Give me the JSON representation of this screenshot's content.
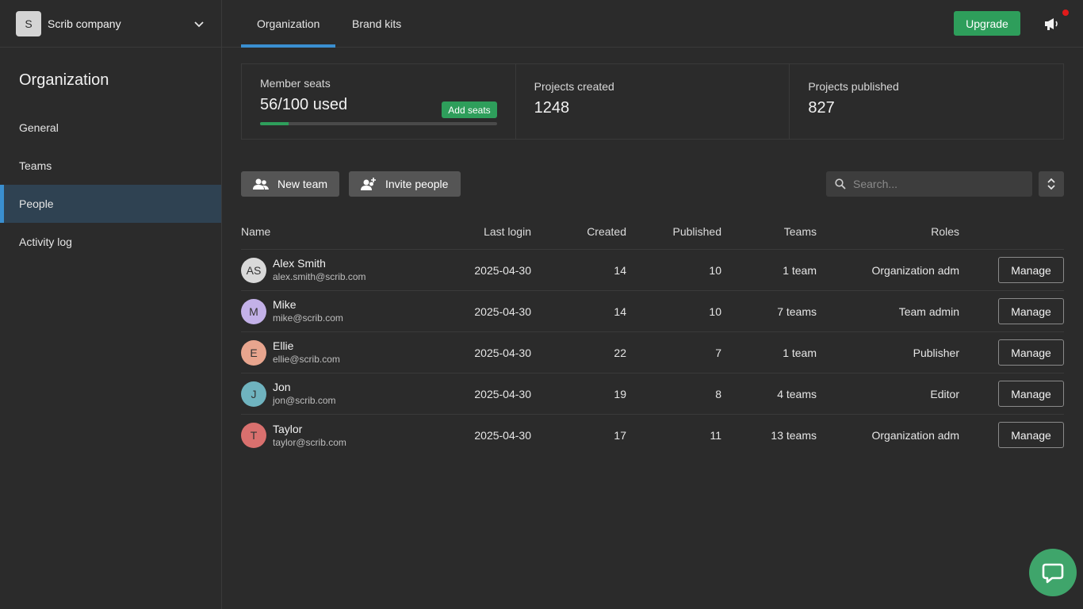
{
  "sidebar": {
    "company_initial": "S",
    "company_name": "Scrib company",
    "title": "Organization",
    "items": [
      {
        "label": "General"
      },
      {
        "label": "Teams"
      },
      {
        "label": "People",
        "active": true
      },
      {
        "label": "Activity log"
      }
    ]
  },
  "header": {
    "tabs": [
      {
        "label": "Organization",
        "active": true
      },
      {
        "label": "Brand kits"
      }
    ],
    "upgrade_label": "Upgrade"
  },
  "stats": {
    "seats": {
      "label": "Member seats",
      "value": "56/100 used",
      "add_label": "Add seats",
      "progress": 0.12
    },
    "created": {
      "label": "Projects created",
      "value": "1248"
    },
    "published": {
      "label": "Projects published",
      "value": "827"
    }
  },
  "toolbar": {
    "new_team_label": "New team",
    "invite_label": "Invite people",
    "search_placeholder": "Search..."
  },
  "table": {
    "headers": {
      "name": "Name",
      "login": "Last login",
      "created": "Created",
      "published": "Published",
      "teams": "Teams",
      "roles": "Roles"
    },
    "manage_label": "Manage",
    "rows": [
      {
        "initials": "AS",
        "avatar_color": "#d9d9d9",
        "name": "Alex Smith",
        "email": "alex.smith@scrib.com",
        "last_login": "2025-04-30",
        "created": "14",
        "published": "10",
        "teams": "1 team",
        "role": "Organization adm"
      },
      {
        "initials": "M",
        "avatar_color": "#c3b1e8",
        "name": "Mike",
        "email": "mike@scrib.com",
        "last_login": "2025-04-30",
        "created": "14",
        "published": "10",
        "teams": "7 teams",
        "role": "Team admin"
      },
      {
        "initials": "E",
        "avatar_color": "#e8a58e",
        "name": "Ellie",
        "email": "ellie@scrib.com",
        "last_login": "2025-04-30",
        "created": "22",
        "published": "7",
        "teams": "1 team",
        "role": "Publisher"
      },
      {
        "initials": "J",
        "avatar_color": "#6fb3bf",
        "name": "Jon",
        "email": "jon@scrib.com",
        "last_login": "2025-04-30",
        "created": "19",
        "published": "8",
        "teams": "4 teams",
        "role": "Editor"
      },
      {
        "initials": "T",
        "avatar_color": "#d9706e",
        "name": "Taylor",
        "email": "taylor@scrib.com",
        "last_login": "2025-04-30",
        "created": "17",
        "published": "11",
        "teams": "13 teams",
        "role": "Organization adm"
      }
    ]
  },
  "colors": {
    "accent": "#3a8fd0",
    "green": "#2e9e5b",
    "notification": "#e01a1a"
  }
}
